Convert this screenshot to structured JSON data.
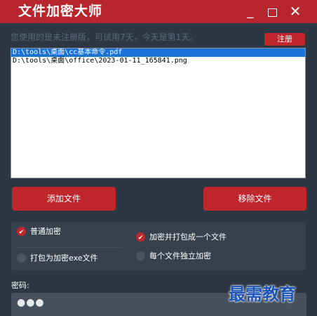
{
  "window": {
    "title": "文件加密大师",
    "minimize": "_",
    "close": "✕"
  },
  "notice": {
    "trial_text": "您使用的是未注册版，可试用7天，今天是第1天。",
    "register_label": "注册"
  },
  "file_list": {
    "items": [
      {
        "path": "D:\\tools\\桌面\\cc基本命令.pdf",
        "selected": true
      },
      {
        "path": "D:\\tools\\桌面\\office\\2023-01-11_165841.png",
        "selected": false
      }
    ]
  },
  "actions": {
    "add_label": "添加文件",
    "remove_label": "移除文件"
  },
  "options": {
    "normal": {
      "label": "普通加密",
      "checked": true
    },
    "pack_exe": {
      "label": "打包为加密exe文件",
      "checked": false
    },
    "pack_one": {
      "label": "加密并打包成一个文件",
      "checked": true
    },
    "each": {
      "label": "每个文件独立加密",
      "checked": false
    }
  },
  "password": {
    "label": "密码:",
    "value": "●●●"
  },
  "watermark": "最需教育",
  "colors": {
    "accent": "#c0272d",
    "background": "#2d3743",
    "selection": "#1a74d8"
  }
}
